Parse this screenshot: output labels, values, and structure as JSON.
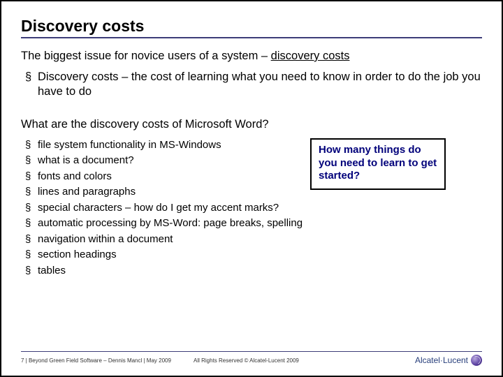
{
  "title": "Discovery costs",
  "lead_pre": "The biggest issue for novice users of a system – ",
  "lead_u": "discovery costs",
  "sub_bullet": "Discovery costs – the cost of learning what you need to know in order to do the job you have to do",
  "question": "What are the discovery costs of Microsoft Word?",
  "items": [
    "file system functionality in MS-Windows",
    "what is a document?",
    "fonts and colors",
    "lines and paragraphs",
    "special characters – how do I get my accent marks?",
    "automatic processing by MS-Word:  page breaks, spelling",
    "navigation within a document",
    "section headings",
    "tables"
  ],
  "callout": "How many things do you need to learn to get started?",
  "footer": {
    "left": "7 | Beyond Green Field Software – Dennis Mancl | May 2009",
    "mid": "All Rights Reserved © Alcatel-Lucent 2009",
    "logo": "Alcatel·Lucent"
  }
}
